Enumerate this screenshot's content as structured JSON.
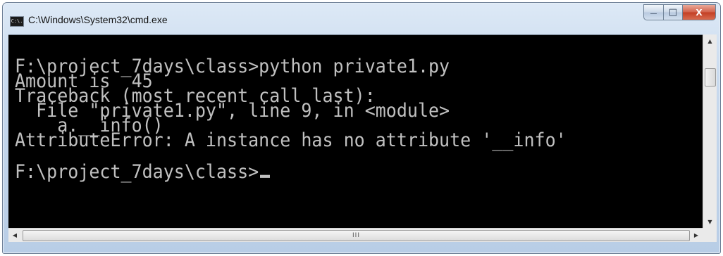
{
  "window": {
    "title": "C:\\Windows\\System32\\cmd.exe",
    "icon_label": "C:\\."
  },
  "buttons": {
    "minimize_glyph": "—",
    "maximize_glyph": "□",
    "close_glyph": "X"
  },
  "console": {
    "lines": [
      "F:\\project_7days\\class>python private1.py",
      "Amount is  45",
      "Traceback (most recent call last):",
      "  File \"private1.py\", line 9, in <module>",
      "    a.__info()",
      "AttributeError: A instance has no attribute '__info'",
      "",
      "F:\\project_7days\\class>"
    ]
  },
  "scrollbars": {
    "up_arrow": "▲",
    "down_arrow": "▼",
    "left_arrow": "◀",
    "right_arrow": "▶",
    "grip": "III"
  },
  "colors": {
    "console_bg": "#000000",
    "console_fg": "#c0c0c0",
    "close_button": "#c33f24"
  }
}
